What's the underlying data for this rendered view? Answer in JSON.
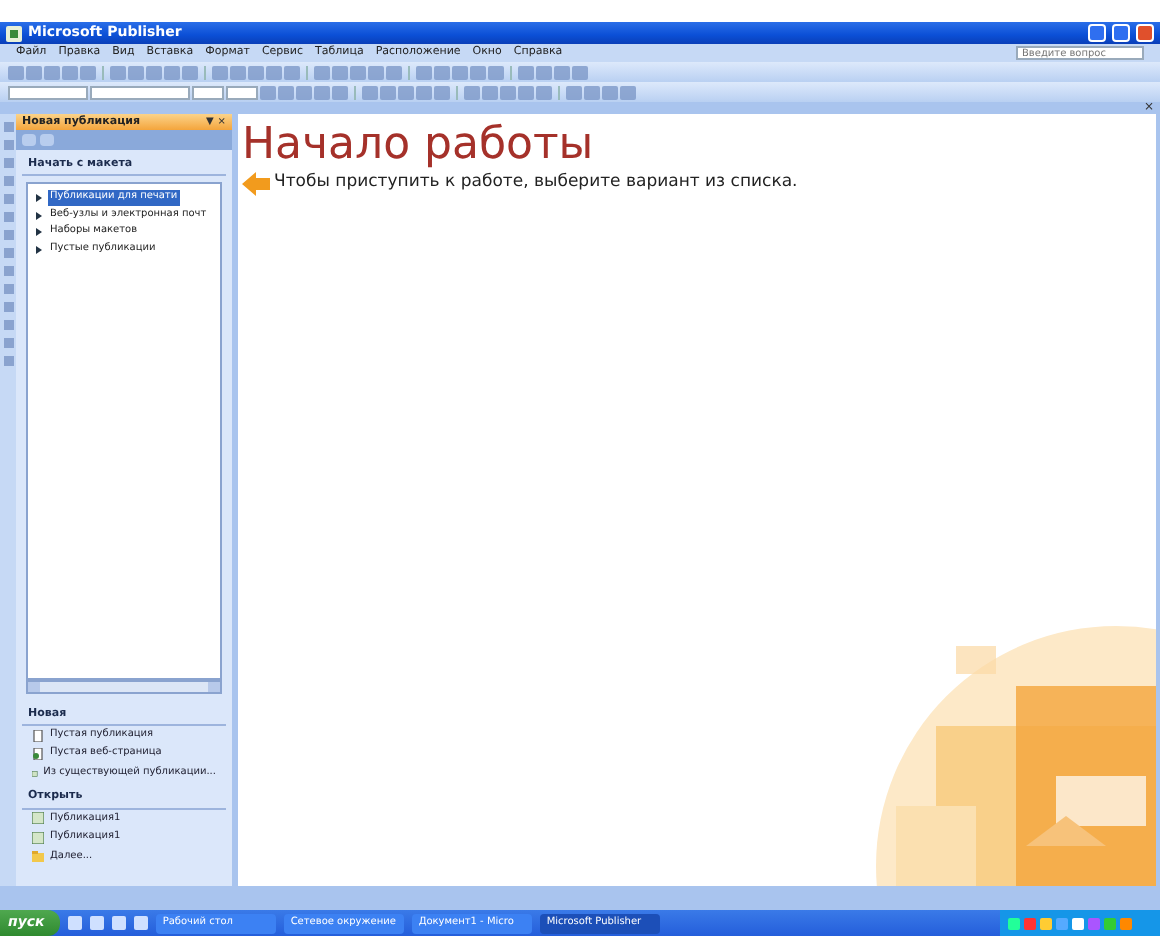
{
  "window": {
    "title": "Microsoft Publisher"
  },
  "menu": [
    "Файл",
    "Правка",
    "Вид",
    "Вставка",
    "Формат",
    "Сервис",
    "Таблица",
    "Расположение",
    "Окно",
    "Справка"
  ],
  "help_search": {
    "placeholder": "Введите вопрос"
  },
  "toolbar_strip": {
    "close_glyph": "×"
  },
  "task_pane": {
    "title": "Новая публикация",
    "menu_glyph": "▼",
    "close_glyph": "×",
    "start_heading": "Начать с макета",
    "templates": [
      {
        "label": "Публикации для печати",
        "selected": true
      },
      {
        "label": "Веб-узлы и электронная почт",
        "selected": false
      },
      {
        "label": "Наборы макетов",
        "selected": false
      },
      {
        "label": "Пустые публикации",
        "selected": false
      }
    ],
    "new_heading": "Новая",
    "new_items": [
      {
        "label": "Пустая публикация",
        "kind": "page"
      },
      {
        "label": "Пустая веб-страница",
        "kind": "web"
      },
      {
        "label": "Из существующей публикации...",
        "kind": "existing"
      }
    ],
    "open_heading": "Открыть",
    "open_items": [
      {
        "label": "Публикация1",
        "kind": "file"
      },
      {
        "label": "Публикация1",
        "kind": "file"
      },
      {
        "label": "Далее...",
        "kind": "folder"
      }
    ]
  },
  "main": {
    "title": "Начало работы",
    "hint": "Чтобы приступить к работе, выберите вариант из списка."
  },
  "taskbar": {
    "start": "пуск",
    "tasks": [
      {
        "label": "Рабочий стол",
        "selected": false
      },
      {
        "label": "Сетевое окружение",
        "selected": false
      },
      {
        "label": "Документ1 - Micro",
        "selected": false
      },
      {
        "label": "Microsoft Publisher",
        "selected": true
      }
    ]
  }
}
